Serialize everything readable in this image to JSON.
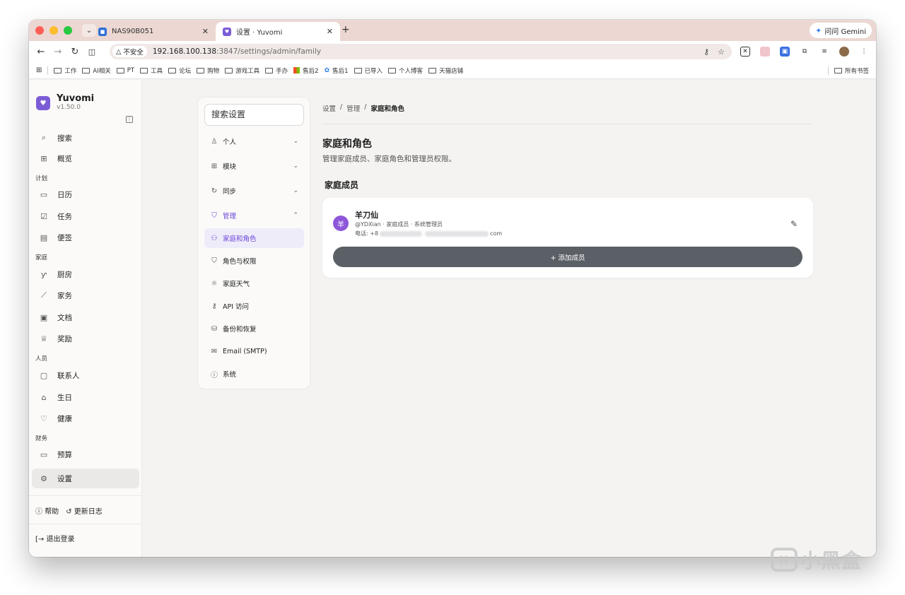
{
  "browser": {
    "tabs": [
      {
        "title": "NAS90B051"
      },
      {
        "title": "设置 · Yuvomi"
      }
    ],
    "gemini_label": "问问 Gemini",
    "security_chip": "不安全",
    "url_host": "192.168.100.138",
    "url_path": ":3847/settings/admin/family",
    "bookmarks": [
      "工作",
      "AI相关",
      "PT",
      "工具",
      "论坛",
      "购物",
      "游戏工具",
      "手办",
      "售后2",
      "售后1",
      "已导入",
      "个人博客",
      "天猫店铺"
    ],
    "all_bookmarks": "所有书签"
  },
  "sidebar": {
    "app_name": "Yuvomi",
    "version": "v1.50.0",
    "items": [
      {
        "label": "搜索",
        "icon": "search-icon"
      },
      {
        "label": "概览",
        "icon": "grid-icon"
      }
    ],
    "sections": [
      {
        "title": "计划",
        "items": [
          {
            "label": "日历",
            "icon": "calendar-icon"
          },
          {
            "label": "任务",
            "icon": "task-check-icon"
          },
          {
            "label": "便签",
            "icon": "note-icon"
          }
        ]
      },
      {
        "title": "家庭",
        "items": [
          {
            "label": "厨房",
            "icon": "utensils-icon"
          },
          {
            "label": "家务",
            "icon": "broom-icon"
          },
          {
            "label": "文档",
            "icon": "folder-icon"
          },
          {
            "label": "奖励",
            "icon": "award-icon"
          }
        ]
      },
      {
        "title": "人员",
        "items": [
          {
            "label": "联系人",
            "icon": "contact-card-icon"
          },
          {
            "label": "生日",
            "icon": "cake-icon"
          },
          {
            "label": "健康",
            "icon": "heart-pulse-icon"
          }
        ]
      },
      {
        "title": "财务",
        "items": [
          {
            "label": "预算",
            "icon": "wallet-icon"
          }
        ]
      }
    ],
    "settings_label": "设置",
    "help_label": "帮助",
    "changelog_label": "更新日志",
    "logout_label": "退出登录"
  },
  "settings_nav": {
    "search_placeholder": "搜索设置",
    "groups": [
      {
        "label": "个人",
        "icon": "user-icon"
      },
      {
        "label": "模块",
        "icon": "grid-icon"
      },
      {
        "label": "同步",
        "icon": "sync-icon"
      },
      {
        "label": "管理",
        "icon": "shield-icon"
      }
    ],
    "admin_items": [
      {
        "label": "家庭和角色",
        "icon": "users-icon"
      },
      {
        "label": "角色与权限",
        "icon": "shield-check-icon"
      },
      {
        "label": "家庭天气",
        "icon": "weather-icon"
      },
      {
        "label": "API 访问",
        "icon": "key-icon"
      },
      {
        "label": "备份和恢复",
        "icon": "database-icon"
      },
      {
        "label": "Email (SMTP)",
        "icon": "mail-icon"
      },
      {
        "label": "系统",
        "icon": "info-icon"
      }
    ]
  },
  "main": {
    "breadcrumb": [
      "设置",
      "管理",
      "家庭和角色"
    ],
    "title": "家庭和角色",
    "description": "管理家庭成员、家庭角色和管理员权限。",
    "section_title": "家庭成员",
    "member": {
      "avatar_char": "羊",
      "name": "羊刀仙",
      "meta": "@YDXian · 家庭成员 · 系统管理员",
      "contact_prefix": "电话: +8",
      "contact_suffix": "com"
    },
    "add_member_label": "+ 添加成员"
  },
  "watermark": "小黑盒",
  "colors": {
    "accent": "#6b46d8",
    "brand_logo": "#7c5cd6",
    "add_button": "#5b5f66",
    "avatar": "#8e57d9"
  }
}
